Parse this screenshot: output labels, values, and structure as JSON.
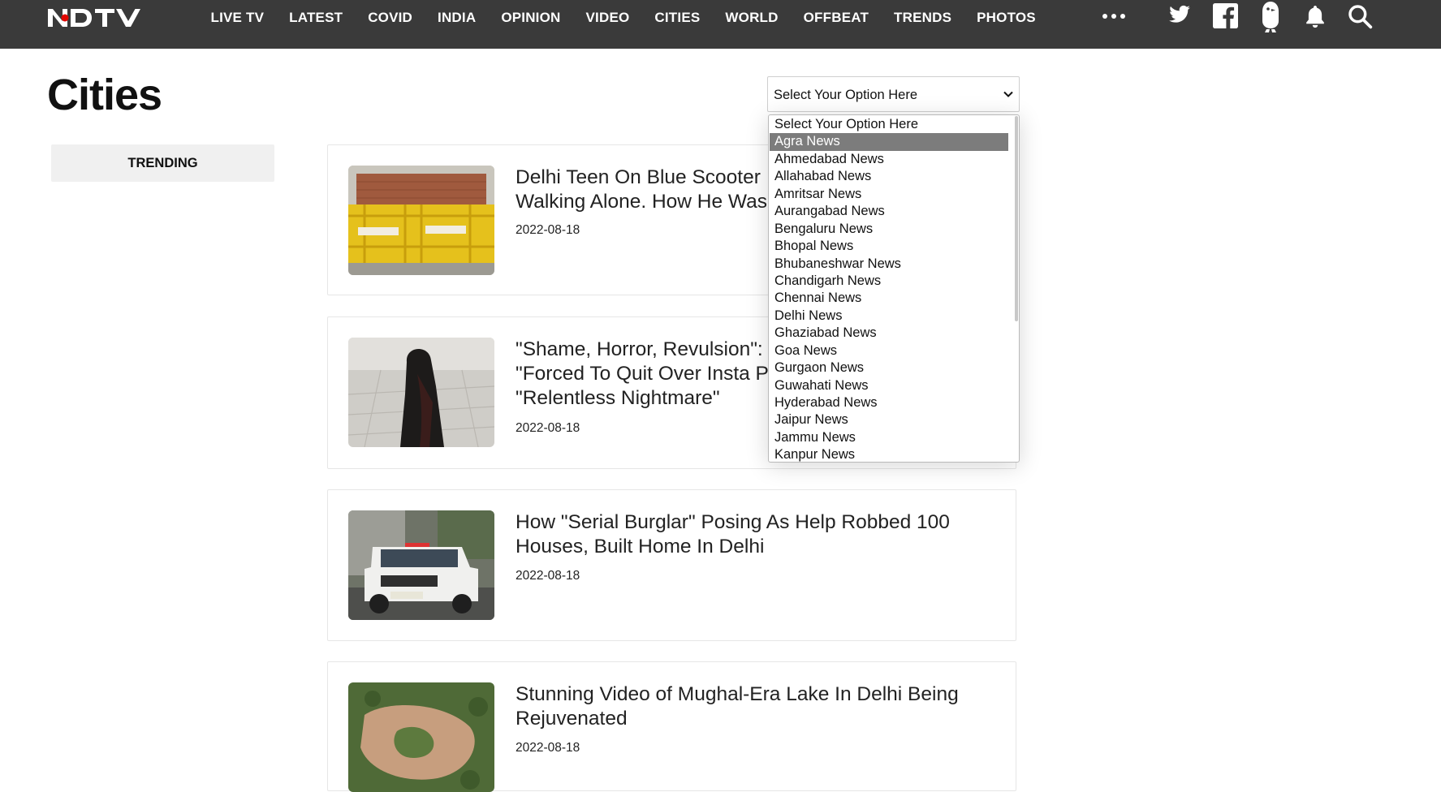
{
  "brand": {
    "logo_text": "NDTV",
    "accent": "#e10600"
  },
  "colors": {
    "nav_bg": "#3a3a3a",
    "tab_bg": "#f0f0f0",
    "option_highlight": "#7c7c7c"
  },
  "nav": {
    "items": [
      "LIVE TV",
      "LATEST",
      "COVID",
      "INDIA",
      "OPINION",
      "VIDEO",
      "CITIES",
      "WORLD",
      "OFFBEAT",
      "TRENDS",
      "PHOTOS"
    ],
    "icons": [
      "more-icon",
      "twitter-icon",
      "facebook-icon",
      "koo-icon",
      "bell-icon",
      "search-icon"
    ]
  },
  "page": {
    "title": "Cities",
    "trending_tab": "TRENDING"
  },
  "city_select": {
    "value": "Select Your Option Here",
    "options": [
      "Select Your Option Here",
      "Agra News",
      "Ahmedabad News",
      "Allahabad News",
      "Amritsar News",
      "Aurangabad News",
      "Bengaluru News",
      "Bhopal News",
      "Bhubaneshwar News",
      "Chandigarh News",
      "Chennai News",
      "Delhi News",
      "Ghaziabad News",
      "Goa News",
      "Gurgaon News",
      "Guwahati News",
      "Hyderabad News",
      "Jaipur News",
      "Jammu News",
      "Kanpur News"
    ],
    "highlighted": "Agra News"
  },
  "articles": [
    {
      "headline": "Delhi Teen On Blue Scooter  Walking Alone. How He Was",
      "line1": "Delhi Teen On Blue Scooter ",
      "line2": "Walking Alone. How He Was",
      "date": "2022-08-18"
    },
    {
      "line1": "\"Shame, Horror, Revulsion\": I",
      "line2": "\"Forced To Quit Over Insta P",
      "line3": "\"Relentless Nightmare\"",
      "date": "2022-08-18"
    },
    {
      "line1": "How \"Serial Burglar\" Posing As Help Robbed 100",
      "line2": "Houses, Built Home In Delhi",
      "date": "2022-08-18"
    },
    {
      "line1": "Stunning Video of Mughal-Era Lake In Delhi Being",
      "line2": "Rejuvenated",
      "date": "2022-08-18"
    }
  ]
}
